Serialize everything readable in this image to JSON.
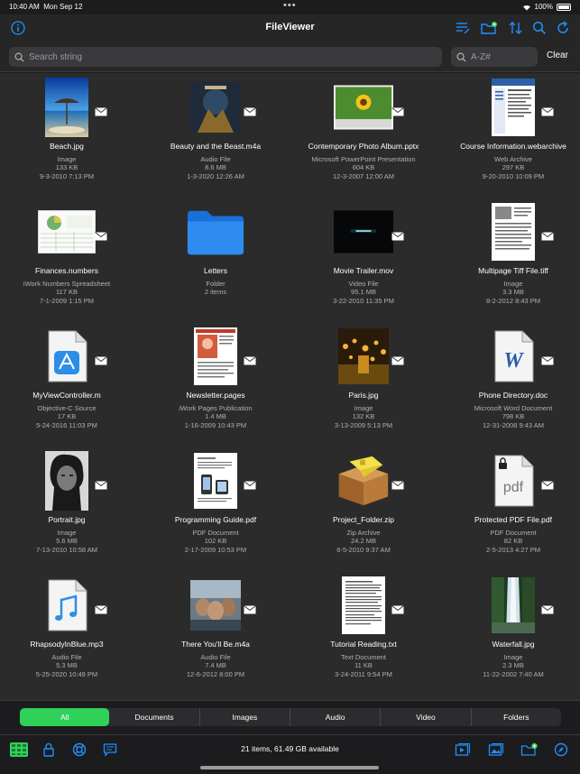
{
  "status_bar": {
    "time": "10:40 AM",
    "date": "Mon Sep 12",
    "battery": "100%",
    "dots": "•••"
  },
  "nav": {
    "title": "FileViewer"
  },
  "search": {
    "placeholder": "Search string",
    "filter_placeholder": "A-Z#",
    "clear_label": "Clear"
  },
  "files": [
    {
      "name": "Beach.jpg",
      "kind": "Image",
      "size": "133 KB",
      "date": "9-3-2010 7:13 PM",
      "thumb": "photo-beach"
    },
    {
      "name": "Beauty and the Beast.m4a",
      "kind": "Audio File",
      "size": "8.6 MB",
      "date": "1-3-2020 12:26 AM",
      "thumb": "album-art"
    },
    {
      "name": "Contemporary Photo Album.pptx",
      "kind": "Microsoft PowerPoint Presentation",
      "size": "604 KB",
      "date": "12-3-2007 12:00 AM",
      "thumb": "slide-sunflower"
    },
    {
      "name": "Course Information.webarchive",
      "kind": "Web Archive",
      "size": "297 KB",
      "date": "9-20-2010 10:09 PM",
      "thumb": "webpage"
    },
    {
      "name": "Finances.numbers",
      "kind": "iWork Numbers Spreadsheet",
      "size": "117 KB",
      "date": "7-1-2009 1:15 PM",
      "thumb": "spreadsheet"
    },
    {
      "name": "Letters",
      "kind": "Folder",
      "size": "2 items",
      "date": "",
      "thumb": "folder"
    },
    {
      "name": "Movie Trailer.mov",
      "kind": "Video File",
      "size": "95.1 MB",
      "date": "3-22-2010 11:35 PM",
      "thumb": "video-frame"
    },
    {
      "name": "Multipage Tiff File.tiff",
      "kind": "Image",
      "size": "3.3 MB",
      "date": "8-2-2012 8:43 PM",
      "thumb": "document-page"
    },
    {
      "name": "MyViewController.m",
      "kind": "Objective-C Source",
      "size": "17 KB",
      "date": "5-24-2016 11:03 PM",
      "thumb": "xcode-file"
    },
    {
      "name": "Newsletter.pages",
      "kind": "iWork Pages Publication",
      "size": "1.4 MB",
      "date": "1-16-2009 10:43 PM",
      "thumb": "newsletter"
    },
    {
      "name": "Paris.jpg",
      "kind": "Image",
      "size": "132 KB",
      "date": "3-13-2009 5:13 PM",
      "thumb": "photo-paris"
    },
    {
      "name": "Phone Directory.doc",
      "kind": "Microsoft Word Document",
      "size": "798 KB",
      "date": "12-31-2008 9:43 AM",
      "thumb": "word-file"
    },
    {
      "name": "Portrait.jpg",
      "kind": "Image",
      "size": "5.6 MB",
      "date": "7-13-2010 10:58 AM",
      "thumb": "photo-portrait"
    },
    {
      "name": "Programming Guide.pdf",
      "kind": "PDF Document",
      "size": "102 KB",
      "date": "2-17-2009 10:53 PM",
      "thumb": "pdf-page"
    },
    {
      "name": "Project_Folder.zip",
      "kind": "Zip Archive",
      "size": "24.2 MB",
      "date": "6-5-2010 9:37 AM",
      "thumb": "zip-box"
    },
    {
      "name": "Protected PDF File.pdf",
      "kind": "PDF Document",
      "size": "82 KB",
      "date": "2-5-2013 4:27 PM",
      "thumb": "pdf-locked"
    },
    {
      "name": "RhapsodyInBlue.mp3",
      "kind": "Audio File",
      "size": "5.3 MB",
      "date": "5-25-2020 10:49 PM",
      "thumb": "music-file"
    },
    {
      "name": "There You'll Be.m4a",
      "kind": "Audio File",
      "size": "7.4 MB",
      "date": "12-6-2012 8:00 PM",
      "thumb": "album-art-2"
    },
    {
      "name": "Tutorial Reading.txt",
      "kind": "Text Document",
      "size": "11 KB",
      "date": "3-24-2011 9:54 PM",
      "thumb": "text-page"
    },
    {
      "name": "Waterfall.jpg",
      "kind": "Image",
      "size": "2.3 MB",
      "date": "11-22-2002 7:40 AM",
      "thumb": "photo-waterfall"
    }
  ],
  "tabs": [
    {
      "label": "All",
      "active": true
    },
    {
      "label": "Documents"
    },
    {
      "label": "Images"
    },
    {
      "label": "Audio"
    },
    {
      "label": "Video"
    },
    {
      "label": "Folders"
    }
  ],
  "toolbar": {
    "status": "21 items, 61.49 GB available"
  },
  "colors": {
    "accent": "#1e90ff",
    "active_tab": "#30d158",
    "background": "#2b2b2b"
  }
}
